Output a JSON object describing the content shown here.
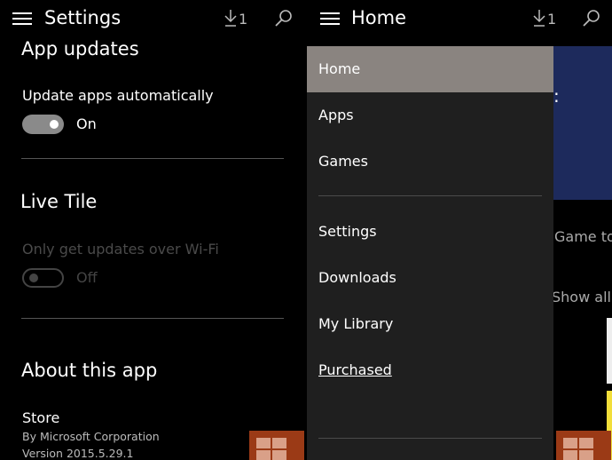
{
  "left": {
    "header": {
      "title": "Settings",
      "download_count": "1"
    },
    "app_updates": {
      "title": "App updates",
      "label": "Update apps automatically",
      "state": "On"
    },
    "live_tile": {
      "title": "Live Tile",
      "label": "Only get updates over Wi-Fi",
      "state": "Off"
    },
    "about": {
      "title": "About this app",
      "app_name": "Store",
      "publisher": "By Microsoft Corporation",
      "version": "Version 2015.5.29.1"
    }
  },
  "right": {
    "header": {
      "title": "Home",
      "download_count": "1"
    },
    "background": {
      "game_top": "Game top",
      "show_all": "Show all"
    },
    "menu": {
      "items": [
        {
          "label": "Home",
          "selected": true
        },
        {
          "label": "Apps"
        },
        {
          "label": "Games"
        },
        {
          "label": "Settings"
        },
        {
          "label": "Downloads"
        },
        {
          "label": "My Library"
        },
        {
          "label": "Purchased"
        }
      ]
    }
  },
  "colors": {
    "selected_item": "#8a8480",
    "drawer_bg": "#1f1f1f",
    "toggle_on": "#8a8a8a",
    "hero_bg": "#1d2a5c",
    "watermark": "#9b3a16"
  }
}
